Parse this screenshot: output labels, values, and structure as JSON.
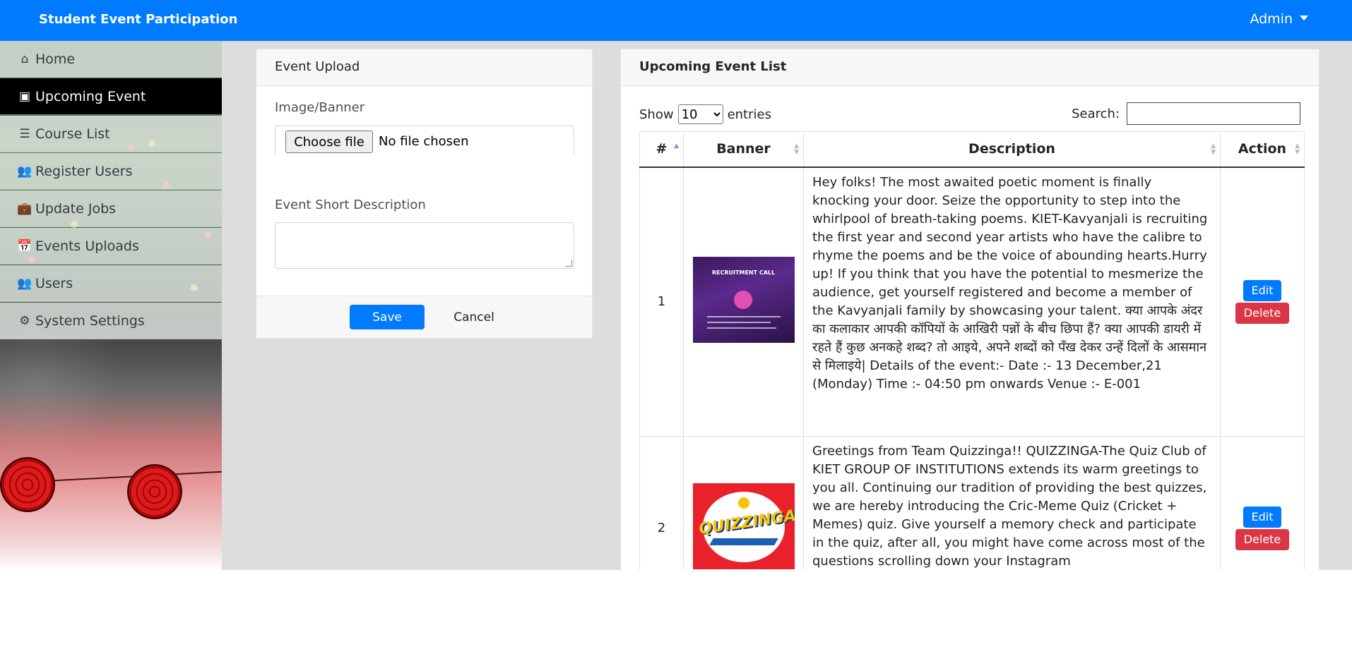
{
  "header": {
    "brand": "Student Event Participation",
    "user_menu": "Admin"
  },
  "sidebar": {
    "items": [
      {
        "label": "Home",
        "icon": "home-icon",
        "glyph": "⌂",
        "active": false
      },
      {
        "label": "Upcoming Event",
        "icon": "image-icon",
        "glyph": "▣",
        "active": true
      },
      {
        "label": "Course List",
        "icon": "list-icon",
        "glyph": "☰",
        "active": false
      },
      {
        "label": "Register Users",
        "icon": "users-icon",
        "glyph": "👥",
        "active": false
      },
      {
        "label": "Update Jobs",
        "icon": "briefcase-icon",
        "glyph": "💼",
        "active": false
      },
      {
        "label": "Events Uploads",
        "icon": "calendar-icon",
        "glyph": "📅",
        "active": false
      },
      {
        "label": "Users",
        "icon": "users-icon",
        "glyph": "👥",
        "active": false
      },
      {
        "label": "System Settings",
        "icon": "cogs-icon",
        "glyph": "⚙",
        "active": false
      }
    ]
  },
  "upload_form": {
    "title": "Event Upload",
    "image_label": "Image/Banner",
    "file_button": "Choose file",
    "file_status": "No file chosen",
    "description_label": "Event Short Description",
    "save_label": "Save",
    "cancel_label": "Cancel"
  },
  "event_list": {
    "title": "Upcoming Event List",
    "show_label": "Show",
    "entries_label": "entries",
    "page_size": "10",
    "search_label": "Search:",
    "columns": [
      "#",
      "Banner",
      "Description",
      "Action"
    ],
    "edit_label": "Edit",
    "delete_label": "Delete",
    "rows": [
      {
        "num": "1",
        "banner": "RECRUITMENT CALL",
        "description": "Hey folks! The most awaited poetic moment is finally knocking your door. Seize the opportunity to step into the whirlpool of breath-taking poems. KIET-Kavyanjali is recruiting the first year and second year artists who have the calibre to rhyme the poems and be the voice of abounding hearts.Hurry up! If you think that you have the potential to mesmerize the audience, get yourself registered and become a member of the Kavyanjali family by showcasing your talent. क्या आपके अंदर का कलाकार आपकी कॉपियों के आखिरी पन्नों के बीच छिपा हैं? क्या आपकी डायरी में रहते हैं कुछ अनकहे शब्द? तो आइये, अपने शब्दों को पँख देकर उन्हें दिलों के आसमान से मिलाइये| Details of the event:- Date :- 13 December,21 (Monday) Time :- 04:50 pm onwards Venue :- E-001"
      },
      {
        "num": "2",
        "banner": "QUIZZINGA",
        "description": "Greetings from Team Quizzinga!! QUIZZINGA-The Quiz Club of KIET GROUP OF INSTITUTIONS extends its warm greetings to you all. Continuing our tradition of providing the best quizzes, we are hereby introducing the Cric-Meme Quiz (Cricket + Memes) quiz. Give yourself a memory check and participate in the quiz, after all, you might have come across most of the questions scrolling down your Instagram"
      }
    ]
  },
  "colors": {
    "primary": "#007bff",
    "danger": "#dc3545",
    "sidebar_active": "#000000"
  }
}
